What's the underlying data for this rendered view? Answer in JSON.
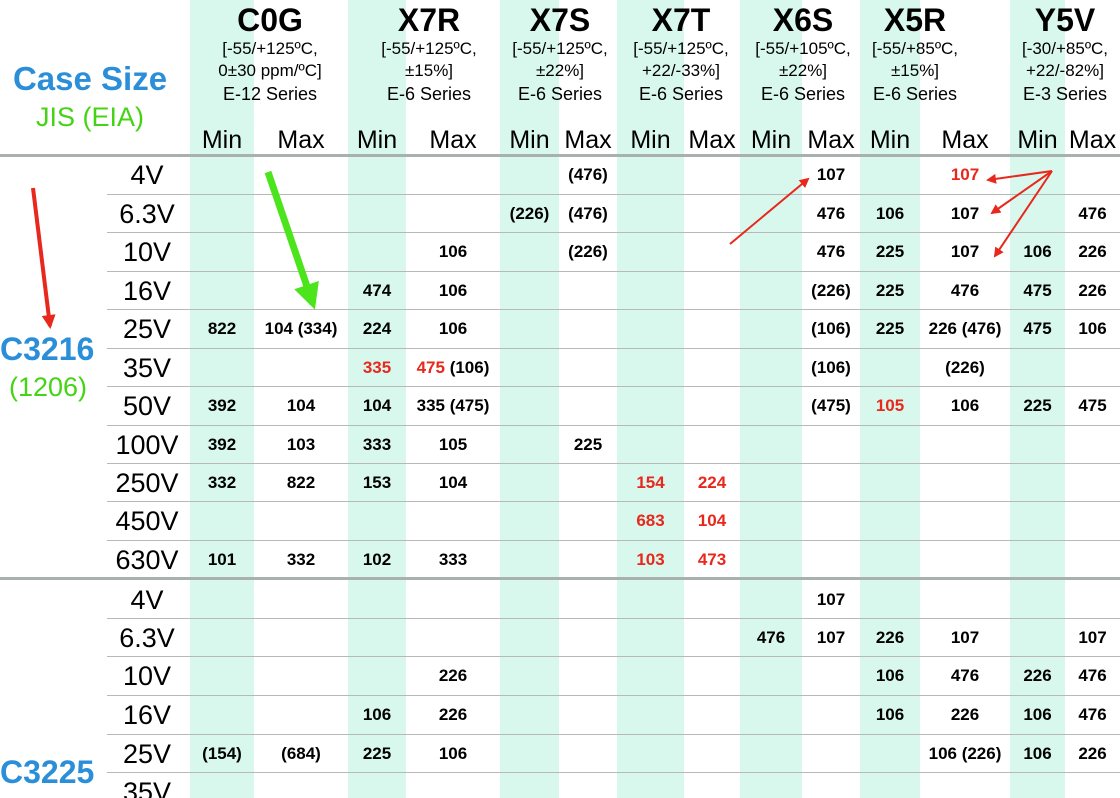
{
  "header": {
    "case_size_title": "Case Size",
    "case_size_sub": "JIS (EIA)",
    "min_label": "Min",
    "max_label": "Max"
  },
  "groups": [
    {
      "name": "C0G",
      "temp": "[-55/+125ºC,",
      "tol": "0±30 ppm/ºC]",
      "series": "E-12 Series"
    },
    {
      "name": "X7R",
      "temp": "[-55/+125ºC,",
      "tol": "±15%]",
      "series": "E-6 Series"
    },
    {
      "name": "X7S",
      "temp": "[-55/+125ºC,",
      "tol": "±22%]",
      "series": "E-6 Series"
    },
    {
      "name": "X7T",
      "temp": "[-55/+125ºC,",
      "tol": "+22/-33%]",
      "series": "E-6 Series"
    },
    {
      "name": "X6S",
      "temp": "[-55/+105ºC,",
      "tol": "±22%]",
      "series": "E-6 Series"
    },
    {
      "name": "X5R",
      "temp": "[-55/+85ºC,",
      "tol": "±15%]",
      "series": "E-6 Series"
    },
    {
      "name": "Y5V",
      "temp": "[-30/+85ºC,",
      "tol": "+22/-82%]",
      "series": "E-3 Series"
    }
  ],
  "cases": [
    {
      "name": "C3216",
      "eia": "(1206)"
    },
    {
      "name": "C3225"
    }
  ],
  "rows": [
    {
      "case": 0,
      "voltage": "4V",
      "cells": [
        {
          "col": 5,
          "text": "(476)"
        },
        {
          "col": 9,
          "text": "107"
        },
        {
          "col": 11,
          "text": "107",
          "color": "red"
        }
      ]
    },
    {
      "case": 0,
      "voltage": "6.3V",
      "cells": [
        {
          "col": 4,
          "text": "(226)"
        },
        {
          "col": 5,
          "text": "(476)"
        },
        {
          "col": 9,
          "text": "476"
        },
        {
          "col": 10,
          "text": "106"
        },
        {
          "col": 11,
          "text": "107"
        },
        {
          "col": 13,
          "text": "476"
        }
      ]
    },
    {
      "case": 0,
      "voltage": "10V",
      "cells": [
        {
          "col": 3,
          "text": "106"
        },
        {
          "col": 5,
          "text": "(226)"
        },
        {
          "col": 9,
          "text": "476"
        },
        {
          "col": 10,
          "text": "225"
        },
        {
          "col": 11,
          "text": "107"
        },
        {
          "col": 12,
          "text": "106"
        },
        {
          "col": 13,
          "text": "226"
        }
      ]
    },
    {
      "case": 0,
      "voltage": "16V",
      "cells": [
        {
          "col": 2,
          "text": "474"
        },
        {
          "col": 3,
          "text": "106"
        },
        {
          "col": 9,
          "text": "(226)"
        },
        {
          "col": 10,
          "text": "225"
        },
        {
          "col": 11,
          "text": "476"
        },
        {
          "col": 12,
          "text": "475"
        },
        {
          "col": 13,
          "text": "226"
        }
      ]
    },
    {
      "case": 0,
      "voltage": "25V",
      "cells": [
        {
          "col": 0,
          "text": "822"
        },
        {
          "col": 1,
          "text": "104 (334)"
        },
        {
          "col": 2,
          "text": "224"
        },
        {
          "col": 3,
          "text": "106"
        },
        {
          "col": 9,
          "text": "(106)"
        },
        {
          "col": 10,
          "text": "225"
        },
        {
          "col": 11,
          "text": "226 (476)"
        },
        {
          "col": 12,
          "text": "475"
        },
        {
          "col": 13,
          "text": "106"
        }
      ]
    },
    {
      "case": 0,
      "voltage": "35V",
      "cells": [
        {
          "col": 2,
          "text": "335",
          "color": "red"
        },
        {
          "col": 3,
          "text": "475",
          "color": "red",
          "extra": " (106)"
        },
        {
          "col": 9,
          "text": "(106)"
        },
        {
          "col": 11,
          "text": "(226)"
        }
      ]
    },
    {
      "case": 0,
      "voltage": "50V",
      "cells": [
        {
          "col": 0,
          "text": "392"
        },
        {
          "col": 1,
          "text": "104"
        },
        {
          "col": 2,
          "text": "104"
        },
        {
          "col": 3,
          "text": "335 (475)"
        },
        {
          "col": 9,
          "text": "(475)"
        },
        {
          "col": 10,
          "text": "105",
          "color": "red"
        },
        {
          "col": 11,
          "text": "106"
        },
        {
          "col": 12,
          "text": "225"
        },
        {
          "col": 13,
          "text": "475"
        }
      ]
    },
    {
      "case": 0,
      "voltage": "100V",
      "cells": [
        {
          "col": 0,
          "text": "392"
        },
        {
          "col": 1,
          "text": "103"
        },
        {
          "col": 2,
          "text": "333"
        },
        {
          "col": 3,
          "text": "105"
        },
        {
          "col": 5,
          "text": "225"
        }
      ]
    },
    {
      "case": 0,
      "voltage": "250V",
      "cells": [
        {
          "col": 0,
          "text": "332"
        },
        {
          "col": 1,
          "text": "822"
        },
        {
          "col": 2,
          "text": "153"
        },
        {
          "col": 3,
          "text": "104"
        },
        {
          "col": 6,
          "text": "154",
          "color": "red"
        },
        {
          "col": 7,
          "text": "224",
          "color": "red"
        }
      ]
    },
    {
      "case": 0,
      "voltage": "450V",
      "cells": [
        {
          "col": 6,
          "text": "683",
          "color": "red"
        },
        {
          "col": 7,
          "text": "104",
          "color": "red"
        }
      ]
    },
    {
      "case": 0,
      "voltage": "630V",
      "cells": [
        {
          "col": 0,
          "text": "101"
        },
        {
          "col": 1,
          "text": "332"
        },
        {
          "col": 2,
          "text": "102"
        },
        {
          "col": 3,
          "text": "333"
        },
        {
          "col": 6,
          "text": "103",
          "color": "red"
        },
        {
          "col": 7,
          "text": "473",
          "color": "red"
        }
      ]
    },
    {
      "case": 1,
      "voltage": "4V",
      "cells": [
        {
          "col": 9,
          "text": "107"
        }
      ]
    },
    {
      "case": 1,
      "voltage": "6.3V",
      "cells": [
        {
          "col": 8,
          "text": "476"
        },
        {
          "col": 9,
          "text": "107"
        },
        {
          "col": 10,
          "text": "226"
        },
        {
          "col": 11,
          "text": "107"
        },
        {
          "col": 13,
          "text": "107"
        }
      ]
    },
    {
      "case": 1,
      "voltage": "10V",
      "cells": [
        {
          "col": 3,
          "text": "226"
        },
        {
          "col": 10,
          "text": "106"
        },
        {
          "col": 11,
          "text": "476"
        },
        {
          "col": 12,
          "text": "226"
        },
        {
          "col": 13,
          "text": "476"
        }
      ]
    },
    {
      "case": 1,
      "voltage": "16V",
      "cells": [
        {
          "col": 2,
          "text": "106"
        },
        {
          "col": 3,
          "text": "226"
        },
        {
          "col": 10,
          "text": "106"
        },
        {
          "col": 11,
          "text": "226"
        },
        {
          "col": 12,
          "text": "106"
        },
        {
          "col": 13,
          "text": "476"
        }
      ]
    },
    {
      "case": 1,
      "voltage": "25V",
      "cells": [
        {
          "col": 0,
          "text": "(154)"
        },
        {
          "col": 1,
          "text": "(684)"
        },
        {
          "col": 2,
          "text": "225"
        },
        {
          "col": 3,
          "text": "106"
        },
        {
          "col": 11,
          "text": "106 (226)"
        },
        {
          "col": 12,
          "text": "106"
        },
        {
          "col": 13,
          "text": "226"
        }
      ]
    },
    {
      "case": 1,
      "voltage": "35V",
      "cells": []
    }
  ],
  "colors": {
    "accent_blue": "#2a8ed8",
    "accent_green": "#44d414",
    "highlight_red": "#e8281c",
    "band": "#d8f8ee"
  }
}
